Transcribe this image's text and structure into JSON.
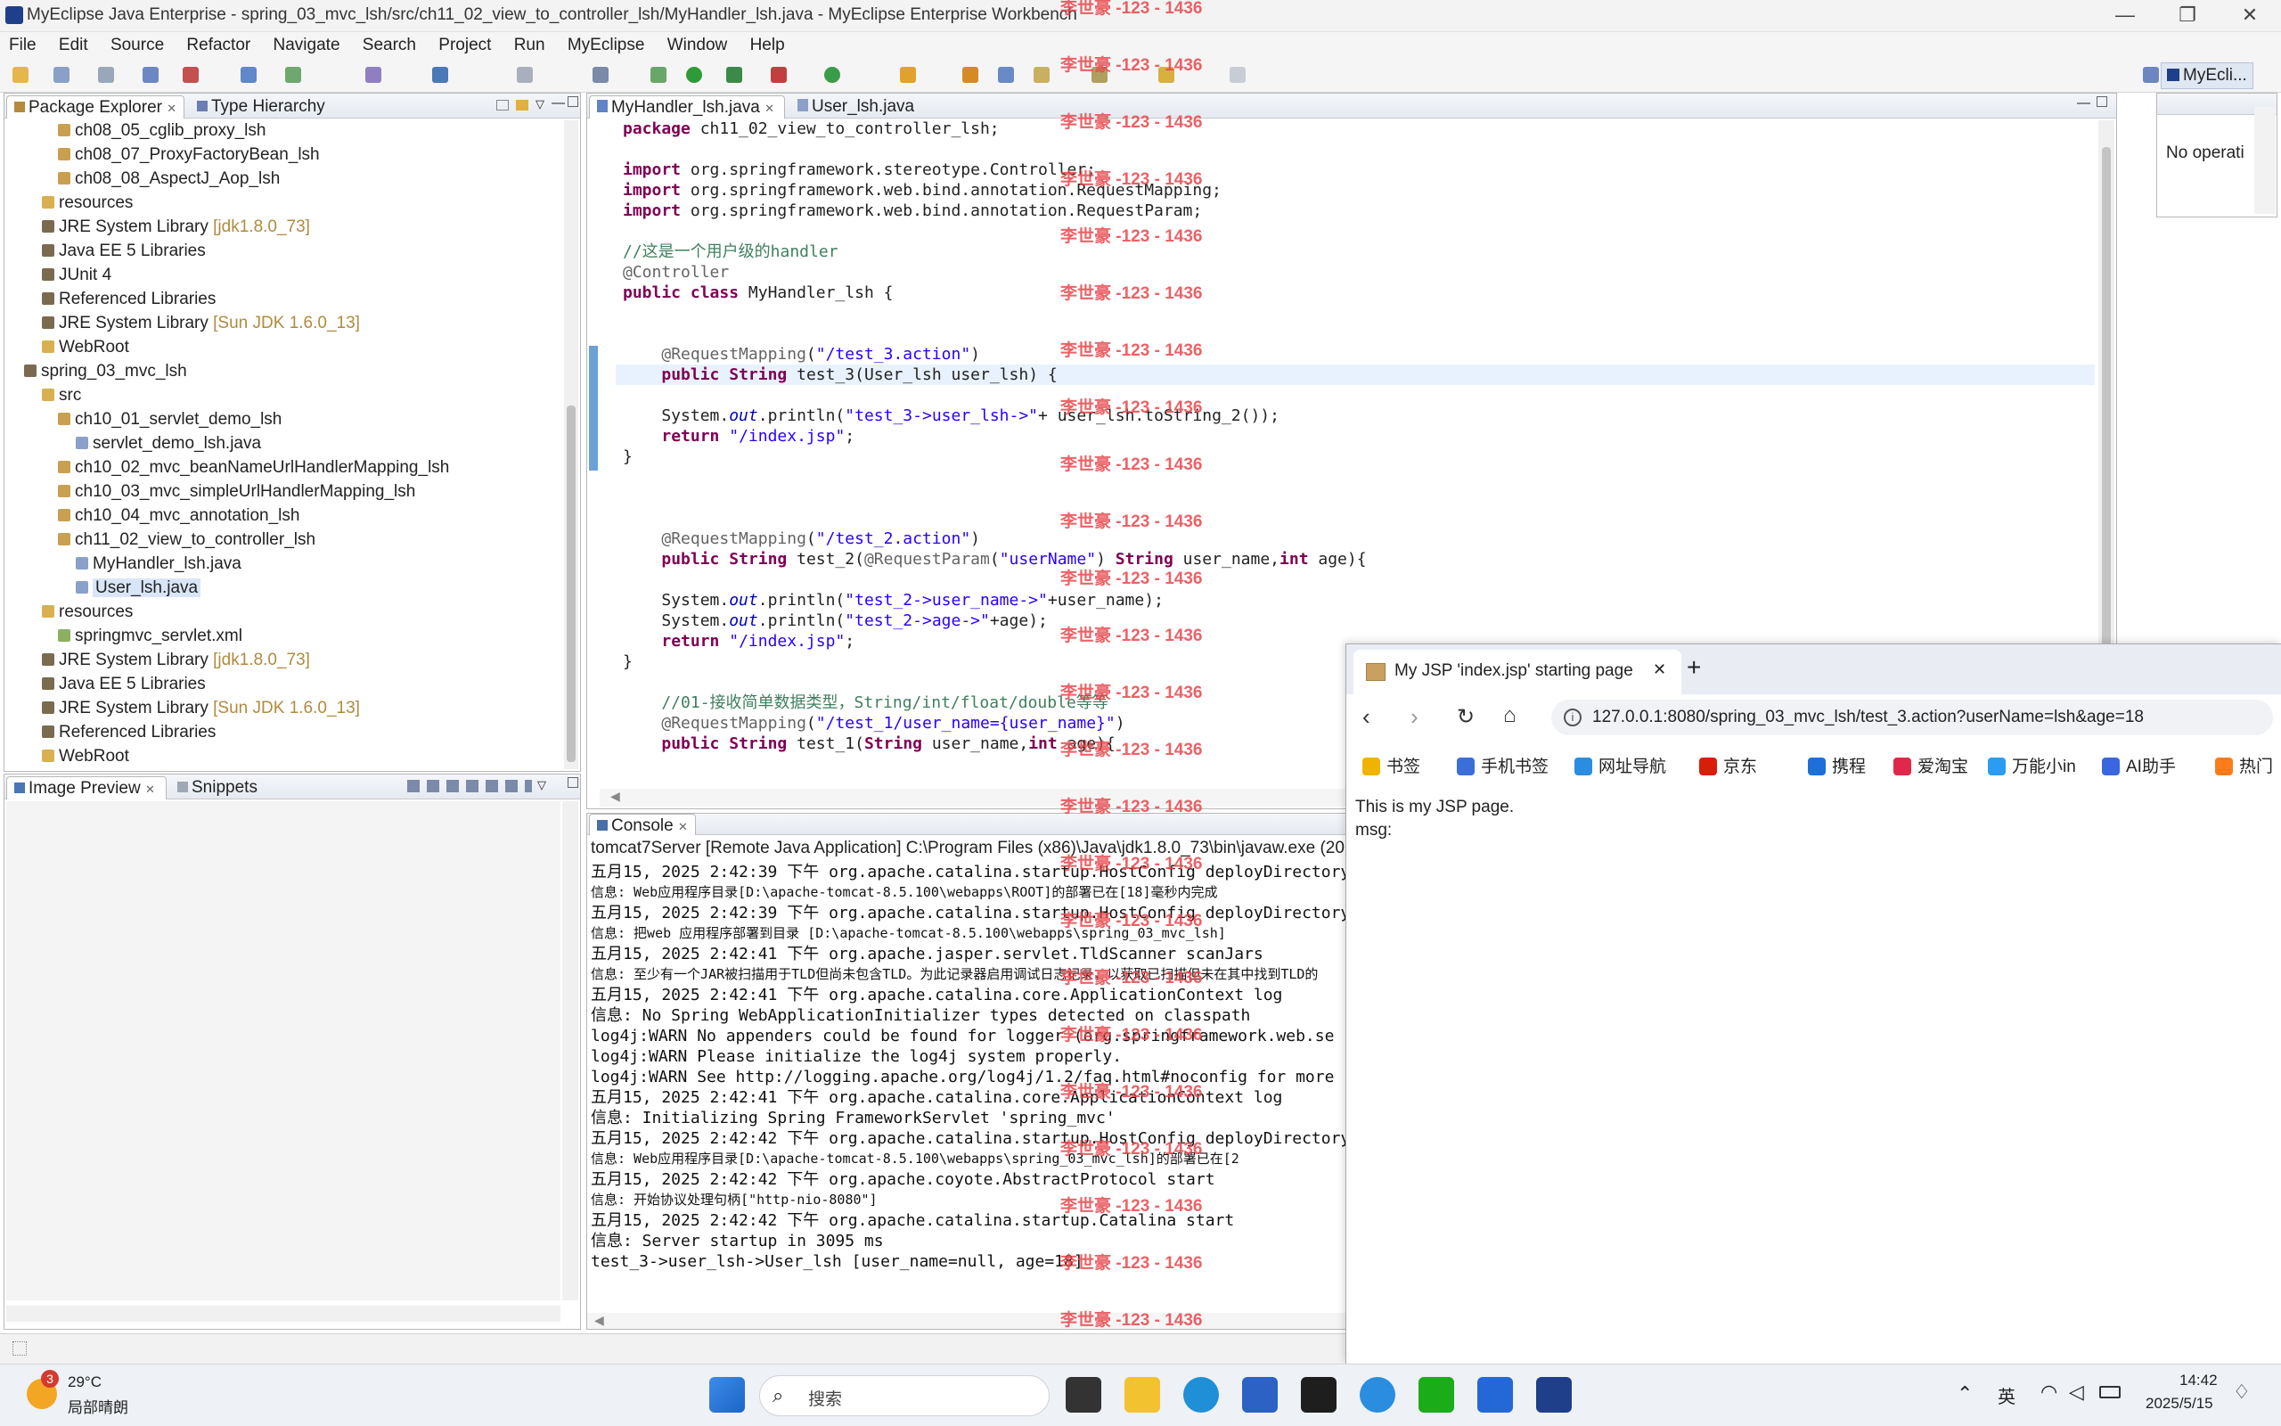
{
  "window": {
    "title": "MyEclipse Java Enterprise - spring_03_mvc_lsh/src/ch11_02_view_to_controller_lsh/MyHandler_lsh.java - MyEclipse Enterprise Workbench",
    "minimize": "—",
    "maximize": "❐",
    "close": "✕"
  },
  "menu": [
    "File",
    "Edit",
    "Source",
    "Refactor",
    "Navigate",
    "Search",
    "Project",
    "Run",
    "MyEclipse",
    "Window",
    "Help"
  ],
  "perspective_label": "MyEcli...",
  "package_explorer": {
    "tab_label": "Package Explorer",
    "tab2_label": "Type Hierarchy",
    "rows": [
      {
        "text": "ch08_05_cglib_proxy_lsh",
        "suffix": ""
      },
      {
        "text": "ch08_07_ProxyFactoryBean_lsh",
        "suffix": ""
      },
      {
        "text": "ch08_08_AspectJ_Aop_lsh",
        "suffix": ""
      },
      {
        "text": "resources",
        "suffix": ""
      },
      {
        "text": "JRE System Library ",
        "suffix": "[jdk1.8.0_73]"
      },
      {
        "text": "Java EE 5 Libraries",
        "suffix": ""
      },
      {
        "text": "JUnit 4",
        "suffix": ""
      },
      {
        "text": "Referenced Libraries",
        "suffix": ""
      },
      {
        "text": "JRE System Library ",
        "suffix": "[Sun JDK 1.6.0_13]"
      },
      {
        "text": "WebRoot",
        "suffix": ""
      },
      {
        "text": "spring_03_mvc_lsh",
        "suffix": ""
      },
      {
        "text": "src",
        "suffix": ""
      },
      {
        "text": "ch10_01_servlet_demo_lsh",
        "suffix": ""
      },
      {
        "text": "servlet_demo_lsh.java",
        "suffix": ""
      },
      {
        "text": "ch10_02_mvc_beanNameUrlHandlerMapping_lsh",
        "suffix": ""
      },
      {
        "text": "ch10_03_mvc_simpleUrlHandlerMapping_lsh",
        "suffix": ""
      },
      {
        "text": "ch10_04_mvc_annotation_lsh",
        "suffix": ""
      },
      {
        "text": "ch11_02_view_to_controller_lsh",
        "suffix": ""
      },
      {
        "text": "MyHandler_lsh.java",
        "suffix": ""
      },
      {
        "text": "User_lsh.java",
        "suffix": ""
      },
      {
        "text": "resources",
        "suffix": ""
      },
      {
        "text": "springmvc_servlet.xml",
        "suffix": ""
      },
      {
        "text": "JRE System Library ",
        "suffix": "[jdk1.8.0_73]"
      },
      {
        "text": "Java EE 5 Libraries",
        "suffix": ""
      },
      {
        "text": "JRE System Library ",
        "suffix": "[Sun JDK 1.6.0_13]"
      },
      {
        "text": "Referenced Libraries",
        "suffix": ""
      },
      {
        "text": "WebRoot",
        "suffix": ""
      }
    ]
  },
  "image_preview": {
    "tab_label": "Image Preview",
    "tab2_label": "Snippets"
  },
  "editor": {
    "tab1": "MyHandler_lsh.java",
    "tab2": "User_lsh.java",
    "lines": [
      "package ch11_02_view_to_controller_lsh;",
      "",
      "import org.springframework.stereotype.Controller;",
      "import org.springframework.web.bind.annotation.RequestMapping;",
      "import org.springframework.web.bind.annotation.RequestParam;",
      "",
      "//这是一个用户级的handler",
      "@Controller",
      "public class MyHandler_lsh {",
      "",
      "",
      "    @RequestMapping(\"/test_3.action\")",
      "    public String test_3(User_lsh user_lsh) {",
      "",
      "    System.out.println(\"test_3->user_lsh->\"+ user_lsh.toString_2());",
      "    return \"/index.jsp\";",
      "}",
      "",
      "",
      "",
      "    @RequestMapping(\"/test_2.action\")",
      "    public String test_2(@RequestParam(\"userName\") String user_name,int age){",
      "",
      "    System.out.println(\"test_2->user_name->\"+user_name);",
      "    System.out.println(\"test_2->age->\"+age);",
      "    return \"/index.jsp\";",
      "}",
      "",
      "    //01-接收简单数据类型，String/int/float/double等等",
      "    @RequestMapping(\"/test_1/user_name={user_name}\")",
      "    public String test_1(String user_name,int age){"
    ]
  },
  "outline": {
    "text": "No operati"
  },
  "console": {
    "tab_label": "Console",
    "header": "tomcat7Server [Remote Java Application] C:\\Program Files (x86)\\Java\\jdk1.8.0_73\\bin\\javaw.exe (20",
    "lines": [
      "五月15, 2025 2:42:39 下午 org.apache.catalina.startup.HostConfig deployDirectory",
      "信息: Web应用程序目录[D:\\apache-tomcat-8.5.100\\webapps\\ROOT]的部署已在[18]毫秒内完成",
      "五月15, 2025 2:42:39 下午 org.apache.catalina.startup.HostConfig deployDirectory",
      "信息: 把web 应用程序部署到目录 [D:\\apache-tomcat-8.5.100\\webapps\\spring_03_mvc_lsh]",
      "五月15, 2025 2:42:41 下午 org.apache.jasper.servlet.TldScanner scanJars",
      "信息: 至少有一个JAR被扫描用于TLD但尚未包含TLD。为此记录器启用调试日志记录，以获取已扫描但未在其中找到TLD的",
      "五月15, 2025 2:42:41 下午 org.apache.catalina.core.ApplicationContext log",
      "信息: No Spring WebApplicationInitializer types detected on classpath",
      "log4j:WARN No appenders could be found for logger (org.springframework.web.se",
      "log4j:WARN Please initialize the log4j system properly.",
      "log4j:WARN See http://logging.apache.org/log4j/1.2/faq.html#noconfig for more",
      "五月15, 2025 2:42:41 下午 org.apache.catalina.core.ApplicationContext log",
      "信息: Initializing Spring FrameworkServlet 'spring_mvc'",
      "五月15, 2025 2:42:42 下午 org.apache.catalina.startup.HostConfig deployDirectory",
      "信息: Web应用程序目录[D:\\apache-tomcat-8.5.100\\webapps\\spring_03_mvc_lsh]的部署已在[2",
      "五月15, 2025 2:42:42 下午 org.apache.coyote.AbstractProtocol start",
      "信息: 开始协议处理句柄[\"http-nio-8080\"]",
      "五月15, 2025 2:42:42 下午 org.apache.catalina.startup.Catalina start",
      "信息: Server startup in 3095 ms",
      "test_3->user_lsh->User_lsh [user_name=null, age=18]"
    ]
  },
  "watermark": "李世豪 -123 - 1436",
  "browser": {
    "tab_title": "My JSP 'index.jsp' starting page",
    "tab_close": "✕",
    "new_tab": "+",
    "url": "127.0.0.1:8080/spring_03_mvc_lsh/test_3.action?userName=lsh&age=18",
    "bookmarks": [
      "书签",
      "手机书签",
      "网址导航",
      "京东",
      "携程",
      "爱淘宝",
      "万能小in",
      "AI助手",
      "热门"
    ],
    "bookmark_colors": [
      "#f0b400",
      "#3b6fd8",
      "#2a8de0",
      "#d81e06",
      "#1e6fd9",
      "#e0284a",
      "#2b9cf2",
      "#3a66e0",
      "#ff7a1a"
    ],
    "page_line1": "This is my JSP page.",
    "page_line2": "msg:"
  },
  "taskbar": {
    "weather_badge": "3",
    "temp": "29°C",
    "weather": "局部晴朗",
    "search_placeholder": "搜索",
    "ime": "英",
    "time": "14:42",
    "date": "2025/5/15"
  }
}
